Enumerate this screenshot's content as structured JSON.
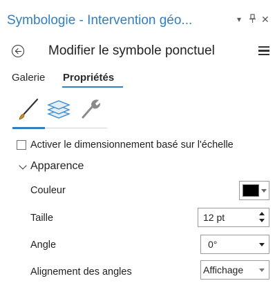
{
  "titlebar": {
    "title": "Symbologie - Intervention géo...",
    "dropdown_glyph": "▾",
    "pin_glyph": "ᵽ",
    "close_glyph": "✕"
  },
  "header": {
    "title": "Modifier le symbole ponctuel",
    "back_icon": "back-circle-arrow-icon",
    "menu_icon": "hamburger-menu-icon"
  },
  "tabs": [
    {
      "label": "Galerie",
      "active": false
    },
    {
      "label": "Propriétés",
      "active": true
    }
  ],
  "tools": [
    {
      "icon": "paintbrush-icon",
      "active": true
    },
    {
      "icon": "layers-icon",
      "active": false
    },
    {
      "icon": "wrench-icon",
      "active": false
    }
  ],
  "scale_checkbox": {
    "label": "Activer le dimensionnement basé sur l'échelle",
    "checked": false
  },
  "appearance": {
    "title": "Apparence",
    "expanded": true,
    "couleur": {
      "label": "Couleur",
      "value": "#000000"
    },
    "taille": {
      "label": "Taille",
      "value": "12 pt"
    },
    "angle": {
      "label": "Angle",
      "value": "0°"
    },
    "alignement": {
      "label": "Alignement des angles",
      "value": "Affichage"
    }
  },
  "colors": {
    "accent": "#2f7fc1",
    "text": "#1f1f1f"
  }
}
